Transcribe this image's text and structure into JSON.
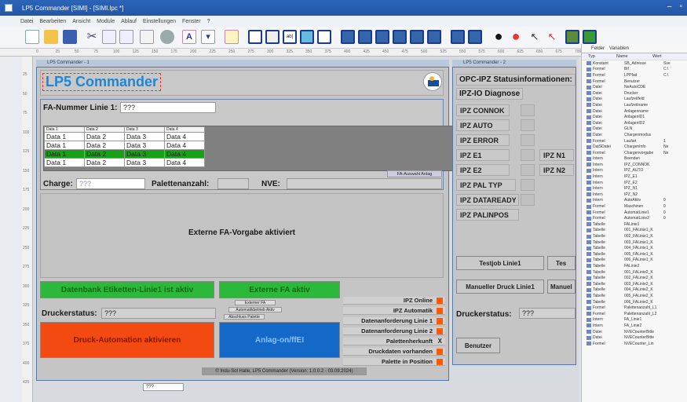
{
  "window": {
    "title": "LP5 Commander [SIMI] - [SIMI.lpc *]"
  },
  "menu": [
    "Datei",
    "Bearbeiten",
    "Ansicht",
    "Module",
    "Ablauf",
    "Einstellungen",
    "Fenster",
    "?"
  ],
  "ruler_marks": [
    "0",
    "25",
    "50",
    "75",
    "100",
    "125",
    "150",
    "175",
    "200",
    "225",
    "250",
    "275",
    "300",
    "325",
    "350",
    "375",
    "400",
    "425",
    "450",
    "475",
    "500",
    "525",
    "550",
    "575",
    "600",
    "625",
    "650",
    "675",
    "700"
  ],
  "vruler_marks": [
    "25",
    "50",
    "75",
    "100",
    "125",
    "150",
    "175",
    "200",
    "225",
    "250",
    "275",
    "300",
    "325",
    "350",
    "375",
    "400",
    "425"
  ],
  "left_window": {
    "tab": "LP5 Commander - 1",
    "app_title": "LP5 Commander",
    "fa_label": "FA-Nummer Linie 1:",
    "fa_value": "???",
    "table": {
      "headers": [
        "Data 1",
        "Data 2",
        "Data 3",
        "Data 4"
      ],
      "rows": [
        [
          "Data 1",
          "Data 2",
          "Data 3",
          "Data 4"
        ],
        [
          "Data 1",
          "Data 2",
          "Data 3",
          "Data 4"
        ],
        [
          "Data 1",
          "Data 2",
          "Data 3",
          "Data 4"
        ],
        [
          "Data 1",
          "Data 2",
          "Data 3",
          "Data 4"
        ]
      ],
      "selected_row": 2
    },
    "fa_auswahl_btn": "FA-Auswahl Anlag",
    "charge_label": "Charge:",
    "charge_value": "???",
    "palettenanzahl_label": "Palettenanzahl:",
    "nve_label": "NVE:",
    "extern_msg": "Externe FA-Vorgabe aktiviert",
    "btn_datenbank": "Datenbank Etiketten-Linie1 ist aktiv",
    "btn_extern_fa": "Externe FA aktiv",
    "small_btns": [
      "Externer FA",
      "Automatikbetrieb Aktiv",
      "Abschluss Palette"
    ],
    "druckerstatus_label": "Druckerstatus:",
    "druckerstatus_value": "???",
    "btn_druck_automation": "Druck-Automation aktivieren",
    "btn_anlage": "Anlag-on/ffEI",
    "status_items": [
      {
        "label": "IPZ Online",
        "marker": "square"
      },
      {
        "label": "IPZ Automatik",
        "marker": "square"
      },
      {
        "label": "Datenanforderung Linie 1",
        "marker": "square"
      },
      {
        "label": "Datenanforderung Linie 2",
        "marker": "square"
      },
      {
        "label": "Palettenherkunft",
        "marker": "X"
      },
      {
        "label": "Druckdaten vorhanden",
        "marker": "square"
      },
      {
        "label": "Palette in Position",
        "marker": "square"
      }
    ],
    "footer": "© Indu-Sol Halle, LP5 Commander  (Version: 1.0.0.2 - 03.09.2024)",
    "small_field": "???"
  },
  "right_window": {
    "tab": "LP5 Commander - 2",
    "title": "OPC-IPZ Statusinformationen:",
    "diag": "IPZ-IO Diagnose",
    "ipz_items": [
      "IPZ CONNOK",
      "IPZ AUTO",
      "IPZ ERROR",
      "IPZ E1",
      "IPZ E2",
      "IPZ PAL TYP",
      "IPZ DATAREADY",
      "IPZ PALINPOS"
    ],
    "ipz_n1": "IPZ N1",
    "ipz_n2": "IPZ N2",
    "btn_testjob": "Testjob Linie1",
    "btn_testjob2": "Tes",
    "btn_manueller": "Manueller Druck Linie1",
    "btn_manueller2": "Manuel",
    "druckerstatus_label": "Druckerstatus:",
    "druckerstatus_value": "???",
    "btn_benutzer": "Benutzer"
  },
  "props_panel": {
    "tabs": [
      "Felder",
      "Variablen"
    ],
    "headers": [
      "Typ",
      "Name",
      "Wert"
    ],
    "rows": [
      [
        "Konstant",
        "SB_Adresse",
        "Sve"
      ],
      [
        "Formel",
        "Bif",
        "C:\\"
      ],
      [
        "Formel",
        "LPPfad",
        "C:\\"
      ],
      [
        "Formel",
        "Benutzer",
        ""
      ],
      [
        "Datei",
        "NeAutoCDE",
        ""
      ],
      [
        "Datei",
        "Drucker",
        ""
      ],
      [
        "Datei",
        "Laufzeitfeld",
        ""
      ],
      [
        "Datei",
        "Laufzeitname",
        ""
      ],
      [
        "Datei",
        "Anlagenname",
        ""
      ],
      [
        "Datei",
        "AnlagenID1",
        ""
      ],
      [
        "Datei",
        "AnlagenID2",
        ""
      ],
      [
        "Datei",
        "GLN",
        ""
      ],
      [
        "Datei",
        "Chargenmodus",
        ""
      ],
      [
        "Formel",
        "Laufart",
        "1"
      ],
      [
        "DatSDatei",
        "ChargenInfo",
        "Ne"
      ],
      [
        "Formel",
        "Chargenvorgabe",
        "Ne"
      ],
      [
        "Intern",
        "Beenden",
        ""
      ],
      [
        "Intern",
        "IPZ_CONNOK",
        ""
      ],
      [
        "Intern",
        "IPZ_AUTO",
        ""
      ],
      [
        "Intern",
        "IPZ_E1",
        ""
      ],
      [
        "Intern",
        "IPZ_E2",
        ""
      ],
      [
        "Intern",
        "IPZ_N1",
        ""
      ],
      [
        "Intern",
        "IPZ_N2",
        ""
      ],
      [
        "Intern",
        "AutoAktiv",
        "0"
      ],
      [
        "Formel",
        "Maschinen",
        "0"
      ],
      [
        "Formel",
        "AutomatLinie1",
        "0"
      ],
      [
        "Formel",
        "AutomatLinie2",
        "0"
      ],
      [
        "Tabelle",
        "FALinie1",
        ""
      ],
      [
        "Tabelle",
        "001_FALinie1_K",
        ""
      ],
      [
        "Tabelle",
        "002_FALinie1_K",
        ""
      ],
      [
        "Tabelle",
        "003_FALinie1_K",
        ""
      ],
      [
        "Tabelle",
        "004_FALinie1_K",
        ""
      ],
      [
        "Tabelle",
        "005_FALinie1_K",
        ""
      ],
      [
        "Tabelle",
        "006_FALinie1_K",
        ""
      ],
      [
        "Tabelle",
        "FALinie2",
        ""
      ],
      [
        "Tabelle",
        "001_FALinie2_K",
        ""
      ],
      [
        "Tabelle",
        "002_FALinie2_K",
        ""
      ],
      [
        "Tabelle",
        "003_FALinie2_K",
        ""
      ],
      [
        "Tabelle",
        "004_FALinie2_K",
        ""
      ],
      [
        "Tabelle",
        "005_FALinie2_K",
        ""
      ],
      [
        "Tabelle",
        "006_FALinie2_K",
        ""
      ],
      [
        "Formel",
        "Palettenanzahl_L1",
        ""
      ],
      [
        "Formel",
        "Palettenanzahl_L2",
        ""
      ],
      [
        "Intern",
        "FA_Linie1",
        ""
      ],
      [
        "Intern",
        "FA_Linie2",
        ""
      ],
      [
        "Datei",
        "NVECounterBitte",
        ""
      ],
      [
        "Datei",
        "NVECounterBitte",
        ""
      ],
      [
        "Formel",
        "NVECounter_Lin",
        ""
      ]
    ]
  },
  "colors": {
    "title_blue": "#1f86d6",
    "green": "#2cb83a",
    "red": "#f24a10",
    "blue": "#1469c8",
    "orange": "#ff5a00"
  }
}
